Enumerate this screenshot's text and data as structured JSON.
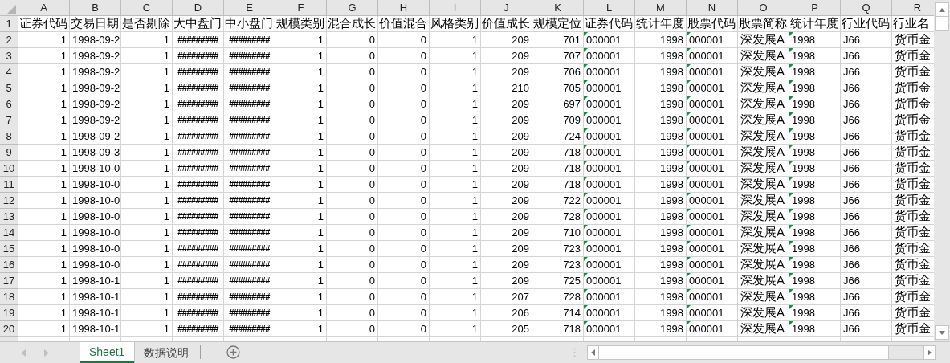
{
  "columns": [
    {
      "letter": "A",
      "kind": "number"
    },
    {
      "letter": "B",
      "kind": "text"
    },
    {
      "letter": "C",
      "kind": "number"
    },
    {
      "letter": "D",
      "kind": "overflow"
    },
    {
      "letter": "E",
      "kind": "overflow"
    },
    {
      "letter": "F",
      "kind": "number"
    },
    {
      "letter": "G",
      "kind": "number"
    },
    {
      "letter": "H",
      "kind": "number"
    },
    {
      "letter": "I",
      "kind": "number"
    },
    {
      "letter": "J",
      "kind": "number"
    },
    {
      "letter": "K",
      "kind": "number"
    },
    {
      "letter": "L",
      "kind": "text_number"
    },
    {
      "letter": "M",
      "kind": "number"
    },
    {
      "letter": "N",
      "kind": "text_number"
    },
    {
      "letter": "O",
      "kind": "text"
    },
    {
      "letter": "P",
      "kind": "text_number"
    },
    {
      "letter": "Q",
      "kind": "text"
    },
    {
      "letter": "R",
      "kind": "text"
    }
  ],
  "header_row": {
    "number": "1",
    "cells": [
      "证券代码",
      "交易日期",
      "是否剔除",
      "大中盘门",
      "中小盘门",
      "规模类别",
      "混合成长",
      "价值混合",
      "风格类别",
      "价值成长",
      "规模定位",
      "证券代码",
      "统计年度",
      "股票代码",
      "股票简称",
      "统计年度",
      "行业代码",
      "行业名"
    ]
  },
  "rows": [
    {
      "number": "2",
      "cells": [
        "1",
        "1998-09-2",
        "1",
        "#########",
        "#########",
        "1",
        "0",
        "0",
        "1",
        "209",
        "701",
        "000001",
        "1998",
        "000001",
        "深发展A",
        "1998",
        "J66",
        "货币金"
      ]
    },
    {
      "number": "3",
      "cells": [
        "1",
        "1998-09-2",
        "1",
        "#########",
        "#########",
        "1",
        "0",
        "0",
        "1",
        "209",
        "707",
        "000001",
        "1998",
        "000001",
        "深发展A",
        "1998",
        "J66",
        "货币金"
      ]
    },
    {
      "number": "4",
      "cells": [
        "1",
        "1998-09-2",
        "1",
        "#########",
        "#########",
        "1",
        "0",
        "0",
        "1",
        "209",
        "706",
        "000001",
        "1998",
        "000001",
        "深发展A",
        "1998",
        "J66",
        "货币金"
      ]
    },
    {
      "number": "5",
      "cells": [
        "1",
        "1998-09-2",
        "1",
        "#########",
        "#########",
        "1",
        "0",
        "0",
        "1",
        "210",
        "705",
        "000001",
        "1998",
        "000001",
        "深发展A",
        "1998",
        "J66",
        "货币金"
      ]
    },
    {
      "number": "6",
      "cells": [
        "1",
        "1998-09-2",
        "1",
        "#########",
        "#########",
        "1",
        "0",
        "0",
        "1",
        "209",
        "697",
        "000001",
        "1998",
        "000001",
        "深发展A",
        "1998",
        "J66",
        "货币金"
      ]
    },
    {
      "number": "7",
      "cells": [
        "1",
        "1998-09-2",
        "1",
        "#########",
        "#########",
        "1",
        "0",
        "0",
        "1",
        "209",
        "709",
        "000001",
        "1998",
        "000001",
        "深发展A",
        "1998",
        "J66",
        "货币金"
      ]
    },
    {
      "number": "8",
      "cells": [
        "1",
        "1998-09-2",
        "1",
        "#########",
        "#########",
        "1",
        "0",
        "0",
        "1",
        "209",
        "724",
        "000001",
        "1998",
        "000001",
        "深发展A",
        "1998",
        "J66",
        "货币金"
      ]
    },
    {
      "number": "9",
      "cells": [
        "1",
        "1998-09-3",
        "1",
        "#########",
        "#########",
        "1",
        "0",
        "0",
        "1",
        "209",
        "718",
        "000001",
        "1998",
        "000001",
        "深发展A",
        "1998",
        "J66",
        "货币金"
      ]
    },
    {
      "number": "10",
      "cells": [
        "1",
        "1998-10-0",
        "1",
        "#########",
        "#########",
        "1",
        "0",
        "0",
        "1",
        "209",
        "718",
        "000001",
        "1998",
        "000001",
        "深发展A",
        "1998",
        "J66",
        "货币金"
      ]
    },
    {
      "number": "11",
      "cells": [
        "1",
        "1998-10-0",
        "1",
        "#########",
        "#########",
        "1",
        "0",
        "0",
        "1",
        "209",
        "718",
        "000001",
        "1998",
        "000001",
        "深发展A",
        "1998",
        "J66",
        "货币金"
      ]
    },
    {
      "number": "12",
      "cells": [
        "1",
        "1998-10-0",
        "1",
        "#########",
        "#########",
        "1",
        "0",
        "0",
        "1",
        "209",
        "722",
        "000001",
        "1998",
        "000001",
        "深发展A",
        "1998",
        "J66",
        "货币金"
      ]
    },
    {
      "number": "13",
      "cells": [
        "1",
        "1998-10-0",
        "1",
        "#########",
        "#########",
        "1",
        "0",
        "0",
        "1",
        "209",
        "728",
        "000001",
        "1998",
        "000001",
        "深发展A",
        "1998",
        "J66",
        "货币金"
      ]
    },
    {
      "number": "14",
      "cells": [
        "1",
        "1998-10-0",
        "1",
        "#########",
        "#########",
        "1",
        "0",
        "0",
        "1",
        "209",
        "710",
        "000001",
        "1998",
        "000001",
        "深发展A",
        "1998",
        "J66",
        "货币金"
      ]
    },
    {
      "number": "15",
      "cells": [
        "1",
        "1998-10-0",
        "1",
        "#########",
        "#########",
        "1",
        "0",
        "0",
        "1",
        "209",
        "723",
        "000001",
        "1998",
        "000001",
        "深发展A",
        "1998",
        "J66",
        "货币金"
      ]
    },
    {
      "number": "16",
      "cells": [
        "1",
        "1998-10-0",
        "1",
        "#########",
        "#########",
        "1",
        "0",
        "0",
        "1",
        "209",
        "723",
        "000001",
        "1998",
        "000001",
        "深发展A",
        "1998",
        "J66",
        "货币金"
      ]
    },
    {
      "number": "17",
      "cells": [
        "1",
        "1998-10-1",
        "1",
        "#########",
        "#########",
        "1",
        "0",
        "0",
        "1",
        "209",
        "725",
        "000001",
        "1998",
        "000001",
        "深发展A",
        "1998",
        "J66",
        "货币金"
      ]
    },
    {
      "number": "18",
      "cells": [
        "1",
        "1998-10-1",
        "1",
        "#########",
        "#########",
        "1",
        "0",
        "0",
        "1",
        "207",
        "728",
        "000001",
        "1998",
        "000001",
        "深发展A",
        "1998",
        "J66",
        "货币金"
      ]
    },
    {
      "number": "19",
      "cells": [
        "1",
        "1998-10-1",
        "1",
        "#########",
        "#########",
        "1",
        "0",
        "0",
        "1",
        "206",
        "714",
        "000001",
        "1998",
        "000001",
        "深发展A",
        "1998",
        "J66",
        "货币金"
      ]
    },
    {
      "number": "20",
      "cells": [
        "1",
        "1998-10-1",
        "1",
        "#########",
        "#########",
        "1",
        "0",
        "0",
        "1",
        "205",
        "718",
        "000001",
        "1998",
        "000001",
        "深发展A",
        "1998",
        "J66",
        "货币金"
      ]
    }
  ],
  "sheet_tabs": [
    {
      "label": "Sheet1",
      "selected": true
    },
    {
      "label": "数据说明",
      "selected": false
    }
  ]
}
